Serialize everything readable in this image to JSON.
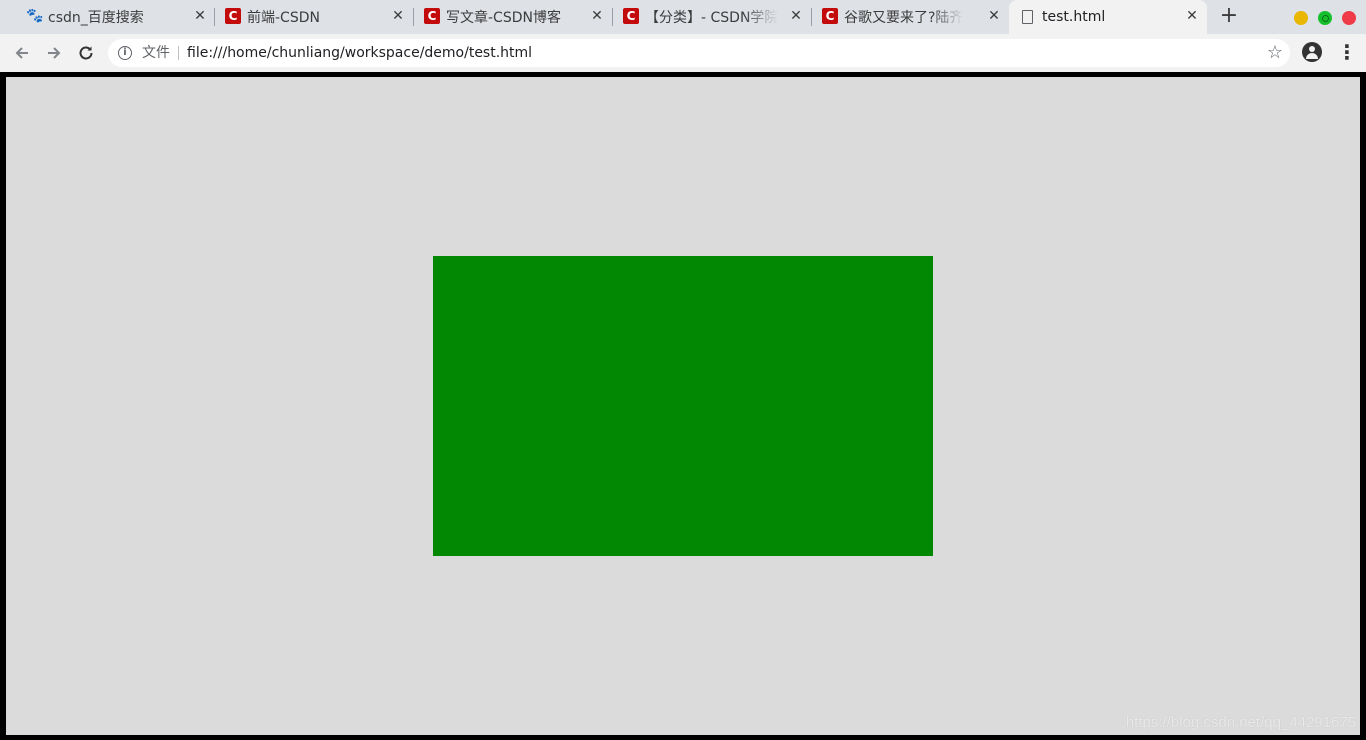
{
  "tabs": [
    {
      "title": "csdn_百度搜索",
      "favicon": "baidu-paw-icon",
      "active": false
    },
    {
      "title": "前端-CSDN",
      "favicon": "csdn-logo-icon",
      "active": false
    },
    {
      "title": "写文章-CSDN博客",
      "favicon": "csdn-logo-icon",
      "active": false
    },
    {
      "title": "【分类】- CSDN学院",
      "favicon": "csdn-logo-icon",
      "active": false
    },
    {
      "title": "谷歌又要来了?陆齐",
      "favicon": "csdn-logo-icon",
      "active": false
    },
    {
      "title": "test.html",
      "favicon": "file-icon",
      "active": true
    }
  ],
  "toolbar": {
    "file_chip": "文件",
    "url": "file:///home/chunliang/workspace/demo/test.html"
  },
  "page": {
    "background": "#dbdbdb",
    "box_color": "#028802"
  },
  "watermark": "https://blog.csdn.net/qq_44291675",
  "colors": {
    "csdn_red": "#c40b0b",
    "window_min": "#e9b700",
    "window_max": "#16c02d",
    "window_close": "#ef3b47"
  }
}
